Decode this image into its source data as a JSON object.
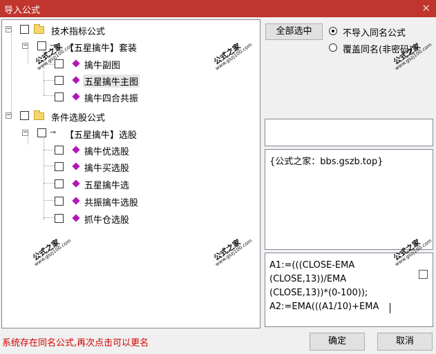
{
  "window": {
    "title": "导入公式",
    "close_glyph": "✕"
  },
  "tree": {
    "expander_collapsed": "−",
    "nodes": [
      {
        "label": "技术指标公式"
      },
      {
        "label": "【五星擒牛】套装"
      },
      {
        "label": "擒牛副图"
      },
      {
        "label": "五星擒牛主图",
        "selected": true
      },
      {
        "label": "擒牛四合共振"
      },
      {
        "label": "条件选股公式"
      },
      {
        "label": "【五星擒牛】选股"
      },
      {
        "label": "擒牛优选股"
      },
      {
        "label": "擒牛买选股"
      },
      {
        "label": "五星擒牛选"
      },
      {
        "label": "共振擒牛选股"
      },
      {
        "label": "抓牛仓选股"
      }
    ]
  },
  "options": {
    "select_all_label": "全部选中",
    "radio_skip_label": "不导入同名公式",
    "radio_overwrite_label": "覆盖同名(非密码)",
    "selected": "skip"
  },
  "description": {
    "text": "{公式之家：bbs.gszb.top}"
  },
  "formula": {
    "text": "A1:=(((CLOSE-EMA\n(CLOSE,13))/EMA\n(CLOSE,13))*(0-100));\nA2:=EMA(((A1/10)+EMA"
  },
  "status": {
    "message": "系统存在同名公式,再次点击可以更名"
  },
  "buttons": {
    "ok_label": "确定",
    "cancel_label": "取消"
  },
  "watermark": {
    "line1": "公式之家",
    "line2": "www.gszj100.com"
  },
  "colors": {
    "titlebar": "#c0352e",
    "status_text": "#d00000",
    "item_icon": "#b216b8",
    "folder_icon": "#f6d66a"
  },
  "icons": {
    "folder": "folder-icon",
    "item": "diamond-icon",
    "group": "key-icon",
    "close": "close-icon"
  }
}
